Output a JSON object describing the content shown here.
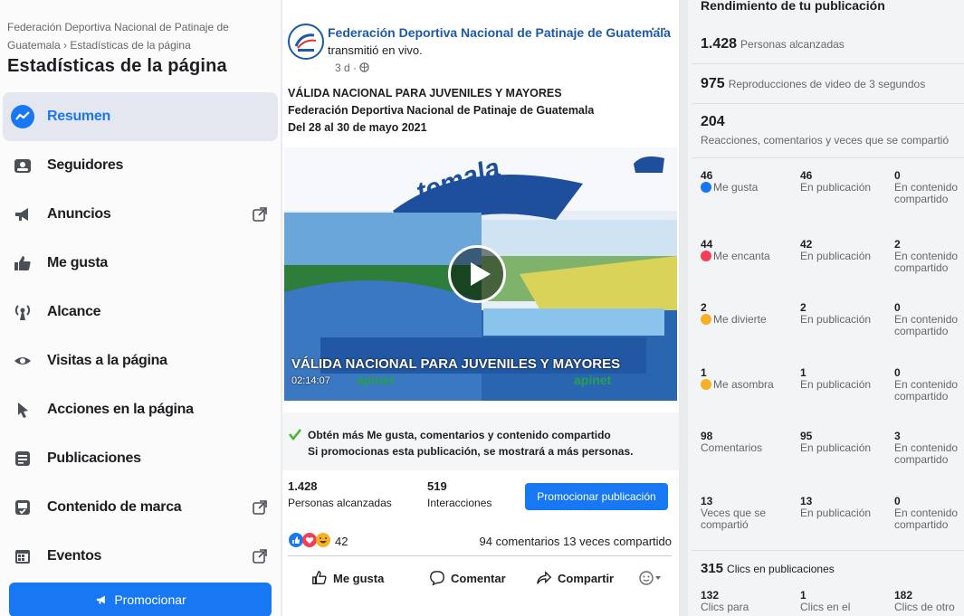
{
  "sidebar": {
    "breadcrumb": "Federación Deportiva Nacional de Patinaje de Guatemala › Estadísticas de la página",
    "title": "Estadísticas de la página",
    "items": [
      {
        "label": "Resumen",
        "icon": "trend-icon",
        "active": true,
        "external": false
      },
      {
        "label": "Seguidores",
        "icon": "followers-icon",
        "active": false,
        "external": false
      },
      {
        "label": "Anuncios",
        "icon": "megaphone-icon",
        "active": false,
        "external": true
      },
      {
        "label": "Me gusta",
        "icon": "thumbs-up-icon",
        "active": false,
        "external": false
      },
      {
        "label": "Alcance",
        "icon": "broadcast-icon",
        "active": false,
        "external": false
      },
      {
        "label": "Visitas a la página",
        "icon": "eye-icon",
        "active": false,
        "external": false
      },
      {
        "label": "Acciones en la página",
        "icon": "cursor-icon",
        "active": false,
        "external": false
      },
      {
        "label": "Publicaciones",
        "icon": "posts-icon",
        "active": false,
        "external": false
      },
      {
        "label": "Contenido de marca",
        "icon": "branded-content-icon",
        "active": false,
        "external": true
      },
      {
        "label": "Eventos",
        "icon": "calendar-icon",
        "active": false,
        "external": true
      }
    ],
    "promote_label": "Promocionar",
    "accent": "#1877f2"
  },
  "post": {
    "page_name": "Federación Deportiva Nacional de Patinaje de Guatemala",
    "action_text": "transmitió en vivo.",
    "time": "3 d ·",
    "text_lines": [
      "VÁLIDA NACIONAL PARA JUVENILES Y MAYORES",
      "Federación Deportiva Nacional de Patinaje de Guatemala",
      "Del 28 al 30 de mayo 2021"
    ],
    "video_title": "VÁLIDA NACIONAL PARA JUVENILES Y MAYORES",
    "video_duration": "02:14:07",
    "tip_title": "Obtén más Me gusta, comentarios y contenido compartido",
    "tip_sub": "Si promocionas esta publicación, se mostrará a más personas.",
    "reach_value": "1.428",
    "reach_label": "Personas alcanzadas",
    "interactions_value": "519",
    "interactions_label": "Interacciones",
    "boost_label": "Promocionar publicación",
    "reaction_count": "42",
    "comments_shares": "94 comentarios 13 veces compartido",
    "actions": {
      "like": "Me gusta",
      "comment": "Comentar",
      "share": "Compartir"
    }
  },
  "performance": {
    "title": "Rendimiento de tu publicación",
    "reach_value": "1.428",
    "reach_label": "Personas alcanzadas",
    "views_value": "975",
    "views_label": "Reproducciones de video de 3 segundos",
    "engagement_value": "204",
    "engagement_label": "Reacciones, comentarios y veces que se compartió",
    "rows": [
      {
        "total": "46",
        "label": "Me gusta",
        "icon": "like-reaction-icon",
        "color": "#1877f2",
        "on_post": "46",
        "on_post_label": "En publicación",
        "on_shares": "0",
        "on_shares_label": "En contenido compartido"
      },
      {
        "total": "44",
        "label": "Me encanta",
        "icon": "love-reaction-icon",
        "color": "#f33e58",
        "on_post": "42",
        "on_post_label": "En publicación",
        "on_shares": "2",
        "on_shares_label": "En contenido compartido"
      },
      {
        "total": "2",
        "label": "Me divierte",
        "icon": "haha-reaction-icon",
        "color": "#f7b125",
        "on_post": "2",
        "on_post_label": "En publicación",
        "on_shares": "0",
        "on_shares_label": "En contenido compartido"
      },
      {
        "total": "1",
        "label": "Me asombra",
        "icon": "wow-reaction-icon",
        "color": "#f7b125",
        "on_post": "1",
        "on_post_label": "En publicación",
        "on_shares": "0",
        "on_shares_label": "En contenido compartido"
      },
      {
        "total": "98",
        "label": "Comentarios",
        "icon": "",
        "color": "",
        "on_post": "95",
        "on_post_label": "En publicación",
        "on_shares": "3",
        "on_shares_label": "En contenido compartido"
      },
      {
        "total": "13",
        "label": "Veces que se compartió",
        "icon": "",
        "color": "",
        "on_post": "13",
        "on_post_label": "En publicación",
        "on_shares": "0",
        "on_shares_label": "En contenido compartido"
      }
    ],
    "clicks_value": "315",
    "clicks_label": "Clics en publicaciones",
    "clicks": [
      {
        "value": "132",
        "label": "Clics para"
      },
      {
        "value": "1",
        "label": "Clics en el"
      },
      {
        "value": "182",
        "label": "Clics de otro"
      }
    ]
  }
}
